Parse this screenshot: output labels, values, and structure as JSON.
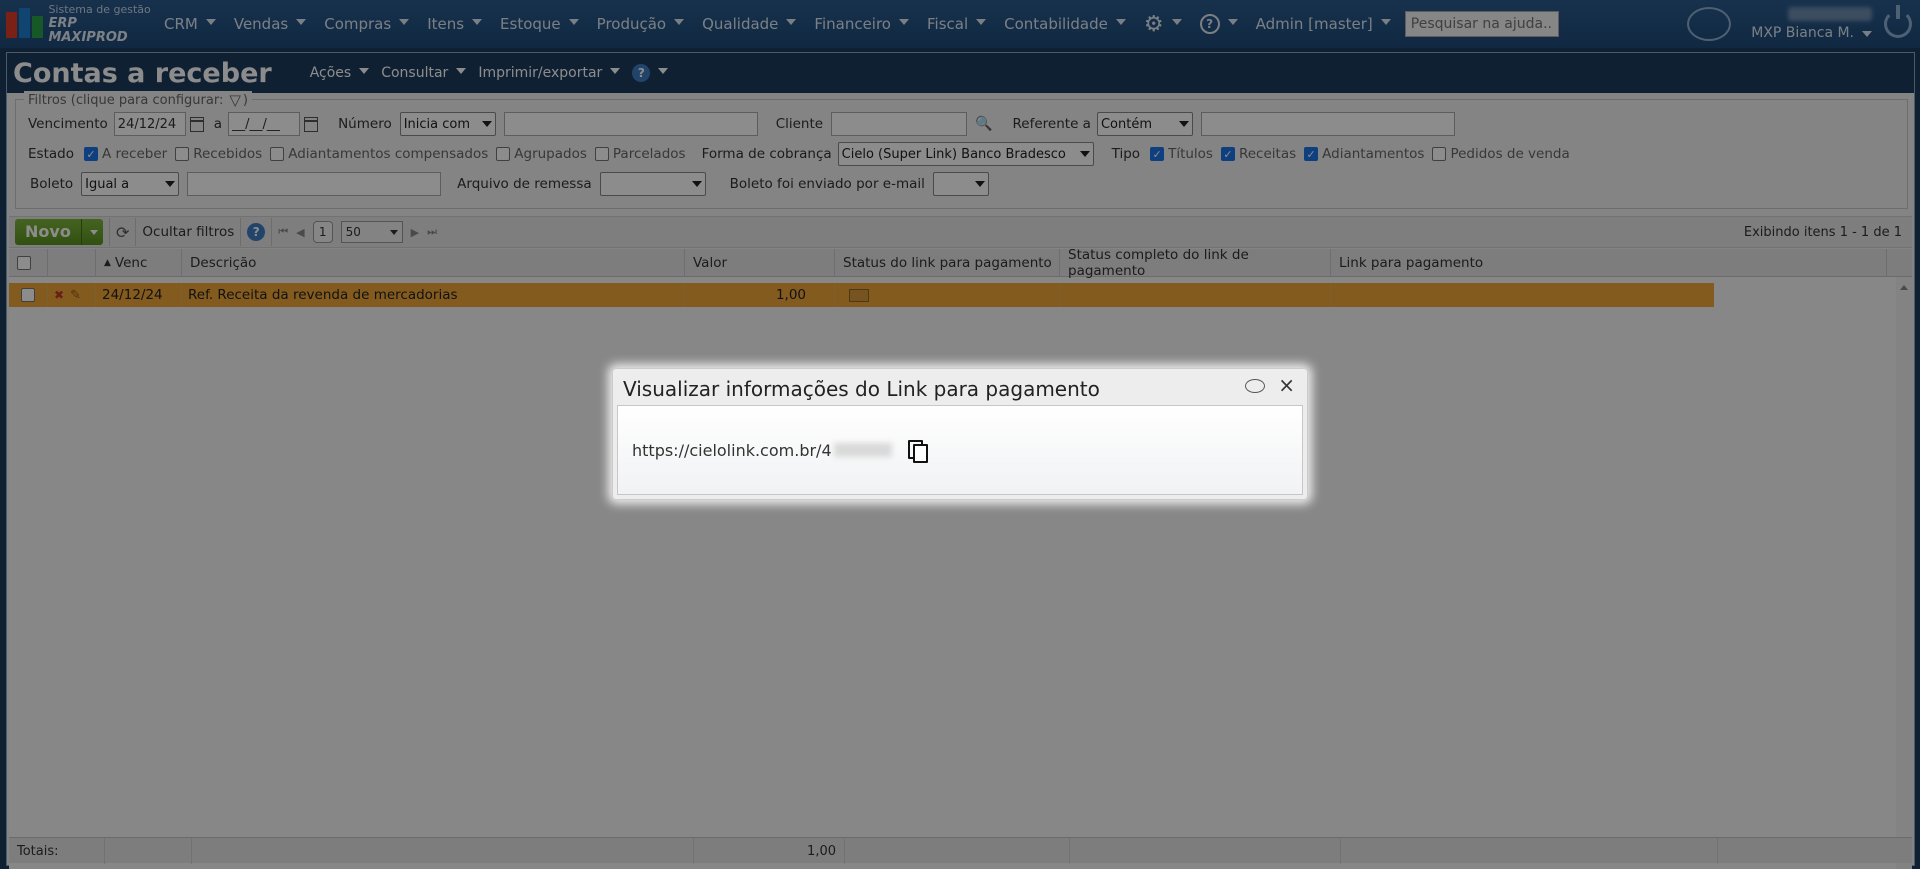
{
  "topbar": {
    "logo_line1": "Sistema de gestão",
    "logo_line2": "ERP MAXIPROD",
    "menu": [
      "CRM",
      "Vendas",
      "Compras",
      "Itens",
      "Estoque",
      "Produção",
      "Qualidade",
      "Financeiro",
      "Fiscal",
      "Contabilidade"
    ],
    "admin": "Admin [master]",
    "help_search_placeholder": "Pesquisar na ajuda...",
    "user": "MXP Bianca M."
  },
  "header": {
    "title": "Contas a receber",
    "menus": [
      "Ações",
      "Consultar",
      "Imprimir/exportar"
    ]
  },
  "filters": {
    "legend": "Filtros (clique para configurar:",
    "legend_close": ")",
    "vencimento_label": "Vencimento",
    "vencimento_from": "24/12/24",
    "vencimento_sep": "a",
    "vencimento_to": "__/__/__",
    "numero_label": "Número",
    "numero_op": "Inicia com",
    "cliente_label": "Cliente",
    "referente_label": "Referente a",
    "referente_op": "Contém",
    "estado_label": "Estado",
    "estado_options": [
      {
        "label": "A receber",
        "checked": true
      },
      {
        "label": "Recebidos",
        "checked": false
      },
      {
        "label": "Adiantamentos compensados",
        "checked": false
      },
      {
        "label": "Agrupados",
        "checked": false
      },
      {
        "label": "Parcelados",
        "checked": false
      }
    ],
    "forma_label": "Forma de cobrança",
    "forma_value": "Cielo (Super Link) Banco Bradesco",
    "tipo_label": "Tipo",
    "tipo_options": [
      {
        "label": "Títulos",
        "checked": true
      },
      {
        "label": "Receitas",
        "checked": true
      },
      {
        "label": "Adiantamentos",
        "checked": true
      },
      {
        "label": "Pedidos de venda",
        "checked": false
      }
    ],
    "boleto_label": "Boleto",
    "boleto_op": "Igual a",
    "arquivo_label": "Arquivo de remessa",
    "boleto_email_label": "Boleto foi enviado por e-mail"
  },
  "toolbar": {
    "novo": "Novo",
    "ocultar": "Ocultar filtros",
    "page": "1",
    "page_size": "50",
    "showing": "Exibindo itens 1 - 1 de 1"
  },
  "grid": {
    "columns": [
      "Venc",
      "Descrição",
      "Valor",
      "Status do link para pagamento",
      "Status completo do link de pagamento",
      "Link para pagamento"
    ],
    "rows": [
      {
        "venc": "24/12/24",
        "descricao": "Ref. Receita da revenda de mercadorias",
        "valor": "1,00"
      }
    ],
    "totals_label": "Totais:",
    "totals_valor": "1,00"
  },
  "modal": {
    "title": "Visualizar informações do Link para pagamento",
    "link_text": "https://cielolink.com.br/4"
  },
  "colors": {
    "selected_row": "#f1a63a",
    "topbar": "#1f4a78",
    "novo_button": "#5a9320"
  }
}
